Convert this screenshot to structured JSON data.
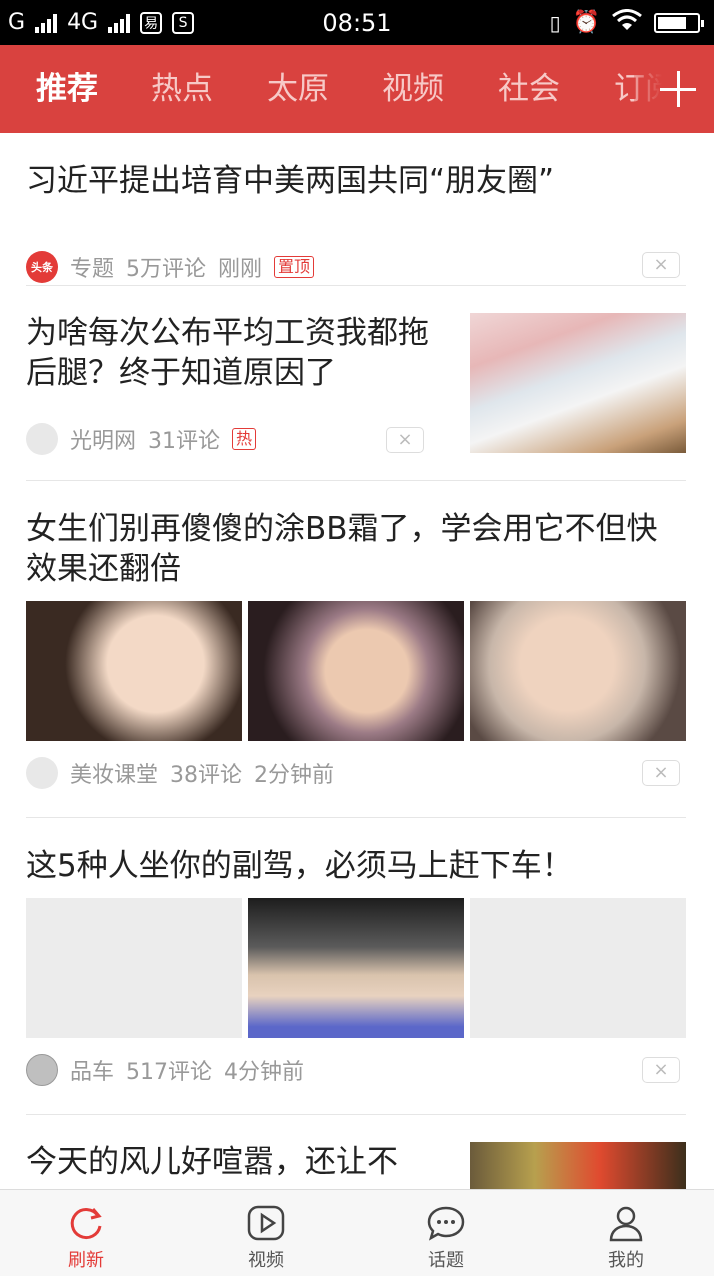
{
  "status_bar": {
    "carrier": "G",
    "network": "4G",
    "time": "08:51",
    "icons": [
      "signal-icon",
      "signal-icon",
      "app-notification-icon",
      "screenshot-icon",
      "vibrate-icon",
      "alarm-icon",
      "wifi-icon",
      "battery-icon"
    ]
  },
  "nav": {
    "tabs": [
      {
        "label": "推荐",
        "active": true
      },
      {
        "label": "热点",
        "active": false
      },
      {
        "label": "太原",
        "active": false
      },
      {
        "label": "视频",
        "active": false
      },
      {
        "label": "社会",
        "active": false
      },
      {
        "label": "订阅",
        "active": false
      }
    ],
    "add_icon": "plus-icon"
  },
  "feed": [
    {
      "title": "习近平提出培育中美两国共同“朋友圈”",
      "source": "专题",
      "comments": "5万评论",
      "time": "刚刚",
      "tag": "置顶",
      "source_icon_text": "头条"
    },
    {
      "title": "为啥每次公布平均工资我都拖后腿？终于知道原因了",
      "source": "光明网",
      "comments": "31评论",
      "tag": "热"
    },
    {
      "title": "女生们别再傻傻的涂BB霜了，学会用它不但快效果还翻倍",
      "source": "美妆课堂",
      "comments": "38评论",
      "time": "2分钟前"
    },
    {
      "title": "这5种人坐你的副驾，必须马上赶下车！",
      "source": "品车",
      "comments": "517评论",
      "time": "4分钟前"
    },
    {
      "title": "今天的风儿好喧嚣，还让不"
    }
  ],
  "dismiss_label": "×",
  "tab_bar": [
    {
      "label": "刷新",
      "icon": "refresh-icon",
      "active": true
    },
    {
      "label": "视频",
      "icon": "play-icon",
      "active": false
    },
    {
      "label": "话题",
      "icon": "chat-icon",
      "active": false
    },
    {
      "label": "我的",
      "icon": "user-icon",
      "active": false
    }
  ],
  "colors": {
    "brand_red": "#d9423f",
    "tag_red": "#e33b38"
  }
}
